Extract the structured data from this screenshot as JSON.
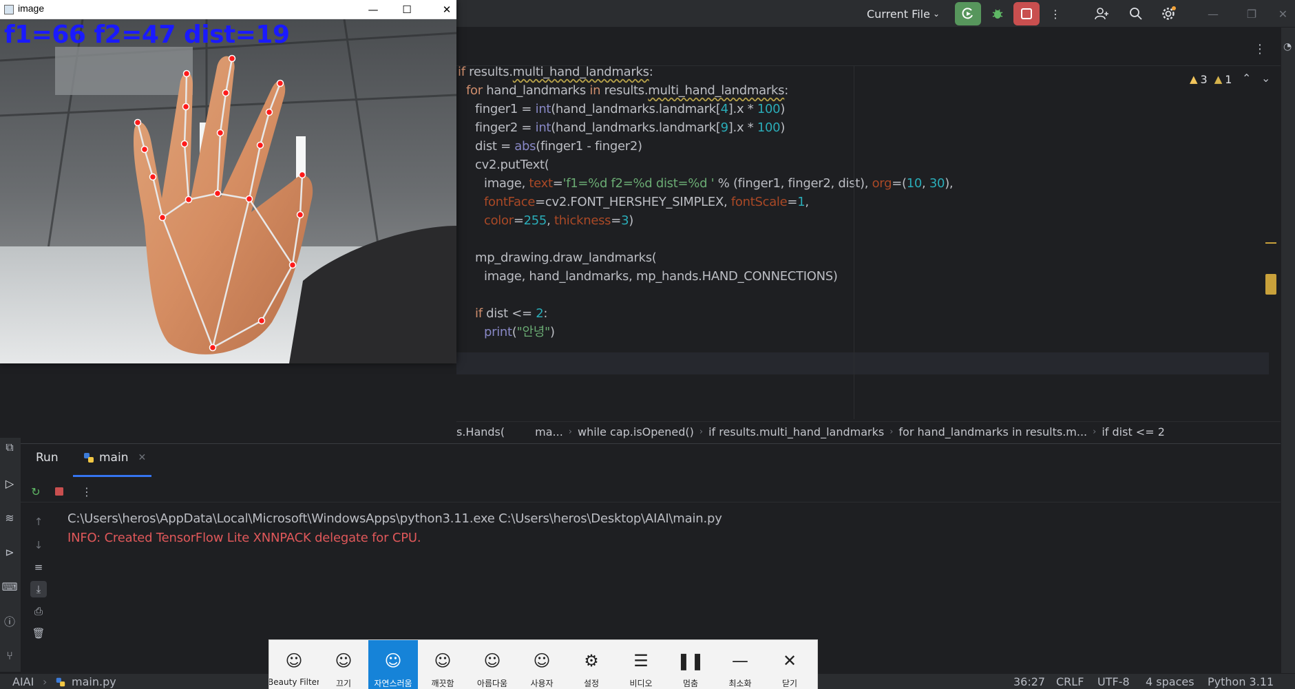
{
  "image_window": {
    "title": "image",
    "overlay_text": "f1=66 f2=47 dist=19",
    "minimize": "—",
    "maximize": "☐",
    "close": "✕"
  },
  "ide_toolbar": {
    "run_config": "Current File",
    "more": "⋮"
  },
  "editor": {
    "lines": [
      {
        "indent": 0,
        "parts": [
          [
            "kw",
            "if "
          ],
          [
            "",
            "results."
          ],
          [
            "wavy",
            "multi_hand_landmarks"
          ],
          [
            "",
            ":"
          ]
        ]
      },
      {
        "indent": 1,
        "parts": [
          [
            "kw",
            "for "
          ],
          [
            "",
            "hand_landmarks "
          ],
          [
            "kw",
            "in "
          ],
          [
            "",
            "results."
          ],
          [
            "wavy",
            "multi_hand_landmarks"
          ],
          [
            "",
            ":"
          ]
        ]
      },
      {
        "indent": 2,
        "parts": [
          [
            "",
            "finger1 = "
          ],
          [
            "bi",
            "int"
          ],
          [
            "",
            "(hand_landmarks.landmark["
          ],
          [
            "num",
            "4"
          ],
          [
            "",
            "].x * "
          ],
          [
            "num",
            "100"
          ],
          [
            "",
            ")"
          ]
        ]
      },
      {
        "indent": 2,
        "parts": [
          [
            "",
            "finger2 = "
          ],
          [
            "bi",
            "int"
          ],
          [
            "",
            "(hand_landmarks.landmark["
          ],
          [
            "num",
            "9"
          ],
          [
            "",
            "].x * "
          ],
          [
            "num",
            "100"
          ],
          [
            "",
            ")"
          ]
        ]
      },
      {
        "indent": 2,
        "parts": [
          [
            "",
            "dist = "
          ],
          [
            "bi",
            "abs"
          ],
          [
            "",
            "(finger1 - finger2)"
          ]
        ]
      },
      {
        "indent": 2,
        "parts": [
          [
            "",
            "cv2.putText("
          ]
        ]
      },
      {
        "indent": 3,
        "parts": [
          [
            "",
            "image, "
          ],
          [
            "par",
            "text"
          ],
          [
            "",
            "="
          ],
          [
            "str",
            "'f1=%d f2=%d dist=%d '"
          ],
          [
            "",
            " % (finger1, finger2, dist), "
          ],
          [
            "par",
            "org"
          ],
          [
            "",
            "=("
          ],
          [
            "num",
            "10"
          ],
          [
            "",
            ", "
          ],
          [
            "num",
            "30"
          ],
          [
            "",
            "),"
          ]
        ]
      },
      {
        "indent": 3,
        "parts": [
          [
            "par",
            "fontFace"
          ],
          [
            "",
            "=cv2.FONT_HERSHEY_SIMPLEX, "
          ],
          [
            "par",
            "fontScale"
          ],
          [
            "",
            "="
          ],
          [
            "num",
            "1"
          ],
          [
            "",
            ","
          ]
        ]
      },
      {
        "indent": 3,
        "parts": [
          [
            "par",
            "color"
          ],
          [
            "",
            "="
          ],
          [
            "num",
            "255"
          ],
          [
            "",
            ", "
          ],
          [
            "par",
            "thickness"
          ],
          [
            "",
            "="
          ],
          [
            "num",
            "3"
          ],
          [
            "",
            ")"
          ]
        ]
      },
      {
        "indent": 2,
        "parts": []
      },
      {
        "indent": 2,
        "parts": [
          [
            "",
            "mp_drawing.draw_landmarks("
          ]
        ]
      },
      {
        "indent": 3,
        "parts": [
          [
            "",
            "image, hand_landmarks, mp_hands.HAND_CONNECTIONS)"
          ]
        ]
      },
      {
        "indent": 2,
        "parts": []
      },
      {
        "indent": 2,
        "parts": [
          [
            "kw",
            "if "
          ],
          [
            "",
            "dist <= "
          ],
          [
            "num",
            "2"
          ],
          [
            "",
            ":"
          ]
        ]
      },
      {
        "indent": 3,
        "parts": [
          [
            "bi",
            "print"
          ],
          [
            "",
            "("
          ],
          [
            "str",
            "\"안녕\""
          ],
          [
            "",
            ")"
          ]
        ]
      }
    ],
    "warnings_count": "3",
    "weak_warnings_count": "1"
  },
  "breadcrumb": {
    "prefix": "s.Hands(",
    "items": [
      "ma...",
      "while cap.isOpened()",
      "if results.multi_hand_landmarks",
      "for hand_landmarks in results.m...",
      "if dist <= 2"
    ]
  },
  "run_panel": {
    "title": "Run",
    "tab": "main",
    "console": [
      {
        "kind": "c-normal",
        "text": "C:\\Users\\heros\\AppData\\Local\\Microsoft\\WindowsApps\\python3.11.exe C:\\Users\\heros\\Desktop\\AIAI\\main.py"
      },
      {
        "kind": "c-err",
        "text": "INFO: Created TensorFlow Lite XNNPACK delegate for CPU."
      }
    ]
  },
  "fx_toolbar": {
    "items": [
      {
        "icon": "☺",
        "label": "Beauty Filter"
      },
      {
        "icon": "☺",
        "label": "끄기"
      },
      {
        "icon": "☺",
        "label": "자연스러움"
      },
      {
        "icon": "☺",
        "label": "깨끗함"
      },
      {
        "icon": "☺",
        "label": "아름다움"
      },
      {
        "icon": "☺",
        "label": "사용자"
      },
      {
        "icon": "⚙",
        "label": "설정"
      },
      {
        "icon": "☰",
        "label": "비디오"
      },
      {
        "icon": "❚❚",
        "label": "멈춤"
      },
      {
        "icon": "—",
        "label": "최소화"
      },
      {
        "icon": "✕",
        "label": "닫기"
      }
    ],
    "active_index": 2
  },
  "statusbar": {
    "project": "AIAI",
    "file": "main.py",
    "position": "36:27",
    "line_sep": "CRLF",
    "encoding": "UTF-8",
    "indent": "4 spaces",
    "interpreter": "Python 3.11"
  },
  "colors": {
    "accent": "#3574f0",
    "run_green": "#57965c",
    "stop_red": "#c94f4f",
    "fx_active": "#1683d8"
  }
}
